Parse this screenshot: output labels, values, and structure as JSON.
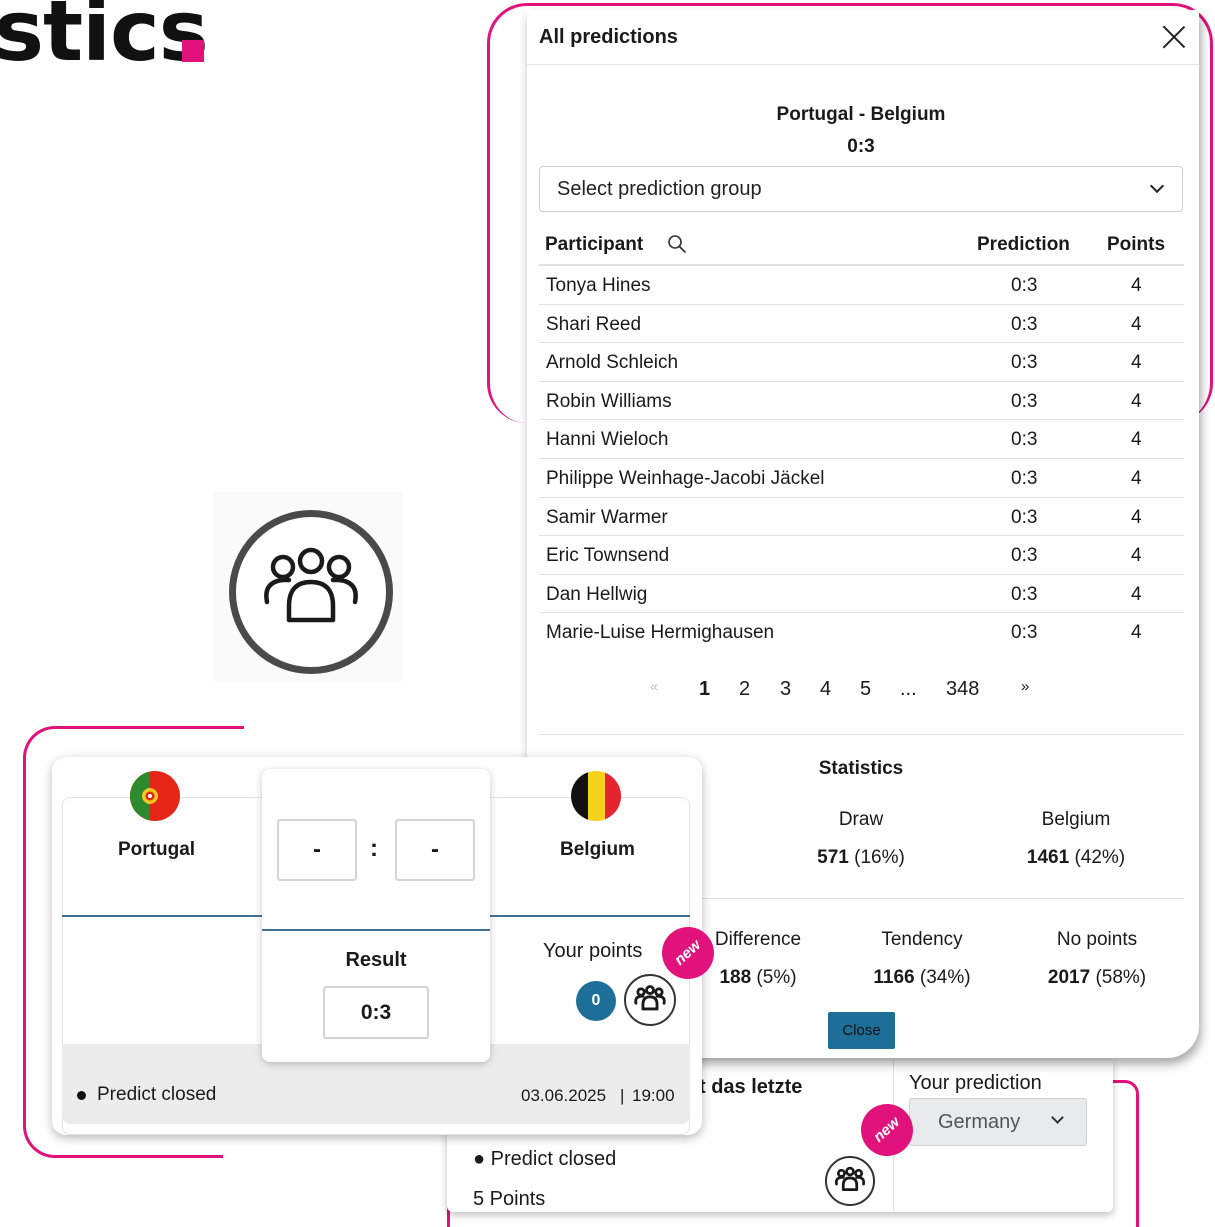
{
  "headline": "stics",
  "modal": {
    "title": "All predictions",
    "match": "Portugal - Belgium",
    "score": "0:3",
    "group_select_placeholder": "Select prediction group",
    "columns": {
      "participant": "Participant",
      "prediction": "Prediction",
      "points": "Points"
    },
    "rows": [
      {
        "name": "Tonya Hines",
        "prediction": "0:3",
        "points": "4"
      },
      {
        "name": "Shari Reed",
        "prediction": "0:3",
        "points": "4"
      },
      {
        "name": "Arnold Schleich",
        "prediction": "0:3",
        "points": "4"
      },
      {
        "name": "Robin Williams",
        "prediction": "0:3",
        "points": "4"
      },
      {
        "name": "Hanni Wieloch",
        "prediction": "0:3",
        "points": "4"
      },
      {
        "name": "Philippe Weinhage-Jacobi Jäckel",
        "prediction": "0:3",
        "points": "4"
      },
      {
        "name": "Samir Warmer",
        "prediction": "0:3",
        "points": "4"
      },
      {
        "name": "Eric Townsend",
        "prediction": "0:3",
        "points": "4"
      },
      {
        "name": "Dan Hellwig",
        "prediction": "0:3",
        "points": "4"
      },
      {
        "name": "Marie-Luise Hermighausen",
        "prediction": "0:3",
        "points": "4"
      }
    ],
    "pagination": {
      "prev": "«",
      "pages": [
        "1",
        "2",
        "3",
        "4",
        "5"
      ],
      "ellipsis": "...",
      "last": "348",
      "next": "»",
      "current": "1"
    },
    "statistics": {
      "title": "Statistics",
      "outcomes": [
        {
          "label": "Draw",
          "count": "571",
          "percent": "(16%)"
        },
        {
          "label": "Belgium",
          "count": "1461",
          "percent": "(42%)"
        }
      ],
      "scoring": [
        {
          "label": "Difference",
          "count": "188",
          "percent": "(5%)"
        },
        {
          "label": "Tendency",
          "count": "1166",
          "percent": "(34%)"
        },
        {
          "label": "No points",
          "count": "2017",
          "percent": "(58%)"
        }
      ]
    },
    "close_label": "Close"
  },
  "match_card": {
    "home_team": "Portugal",
    "away_team": "Belgium",
    "home_input": "-",
    "away_input": "-",
    "separator": ":",
    "result_label": "Result",
    "result": "0:3",
    "your_points_label": "Your points",
    "points": "0",
    "new_badge": "new",
    "status": "Predict closed",
    "date": "03.06.2025",
    "time_separator": "|",
    "time": "19:00"
  },
  "bottom_card": {
    "title_fragment": "t das letzte",
    "status": "Predict closed",
    "points": "5 Points",
    "your_prediction_label": "Your prediction",
    "selected_prediction": "Germany",
    "new_badge": "new"
  },
  "colors": {
    "accent": "#e2127d",
    "primary": "#1d6f98",
    "divider": "#3f7290"
  },
  "icons": [
    "search-icon",
    "close-icon",
    "chevron-down-icon",
    "group-icon"
  ]
}
